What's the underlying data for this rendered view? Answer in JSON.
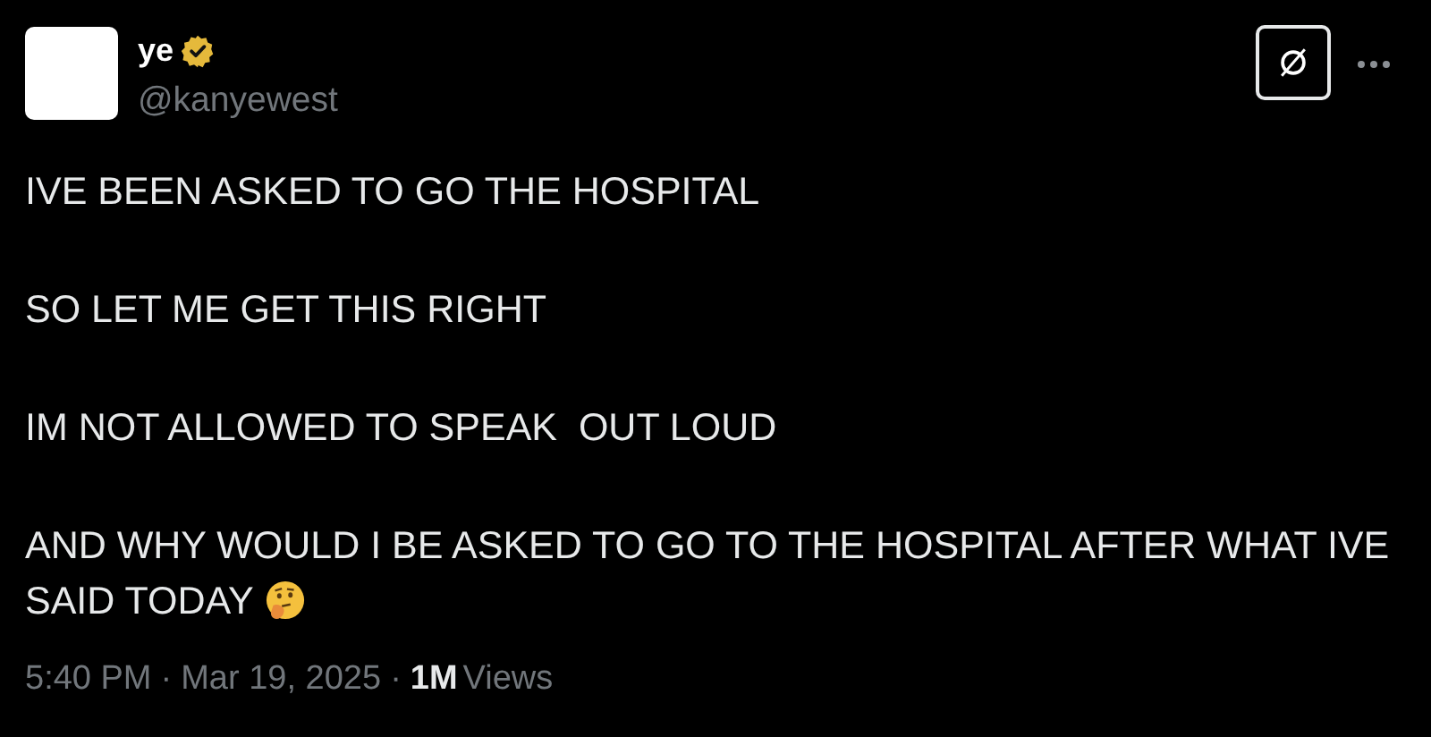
{
  "author": {
    "name": "ye",
    "verified": true,
    "handle": "@kanyewest"
  },
  "paragraphs": [
    "IVE BEEN ASKED TO GO THE HOSPITAL",
    "SO LET ME GET THIS RIGHT",
    "IM NOT ALLOWED TO SPEAK  OUT LOUD",
    "AND WHY WOULD I BE ASKED TO GO TO THE HOSPITAL AFTER WHAT IVE SAID TODAY"
  ],
  "meta": {
    "time": "5:40 PM",
    "separator_1": "·",
    "date": "Mar 19, 2025",
    "separator_2": "·",
    "views_count": "1M",
    "views_label": "Views"
  }
}
